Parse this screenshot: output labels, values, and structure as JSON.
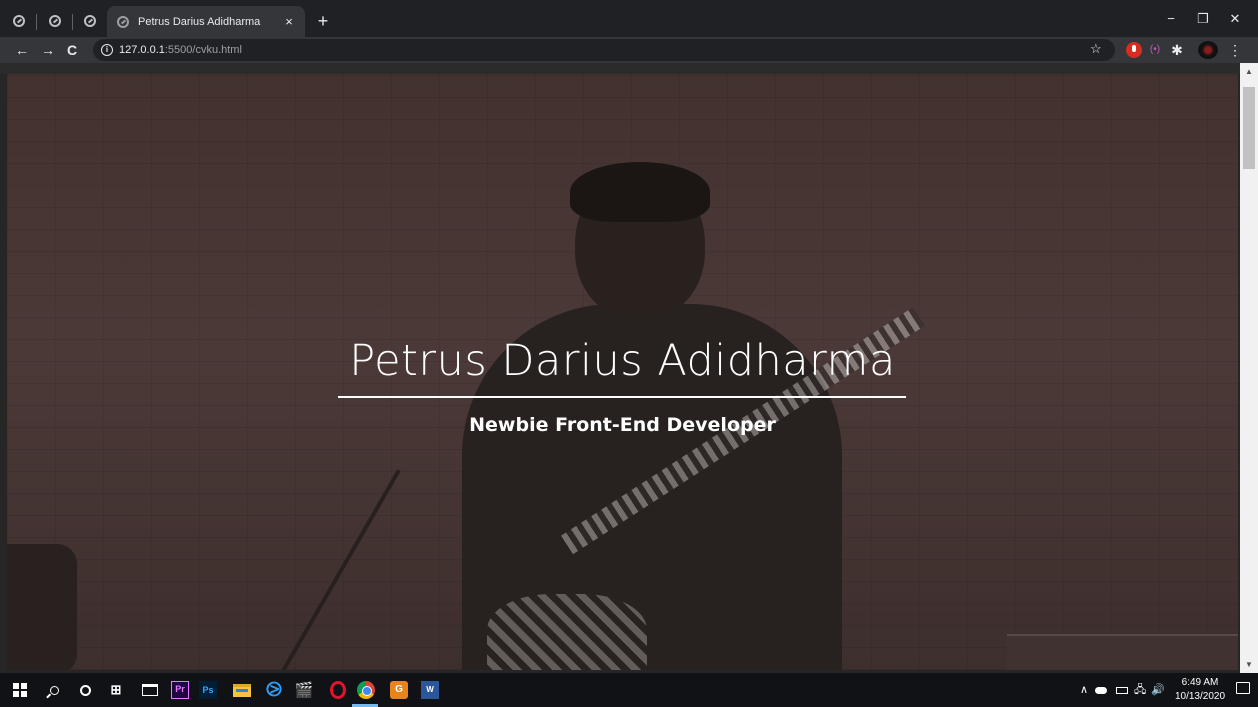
{
  "browser": {
    "pinned_tabs": [
      "",
      "",
      ""
    ],
    "active_tab": {
      "title": "Petrus Darius Adidharma",
      "close": "×"
    },
    "new_tab": "+",
    "window_controls": {
      "minimize": "−",
      "maximize": "❐",
      "close": "✕"
    },
    "toolbar": {
      "back": "←",
      "forward": "→",
      "reload": "C",
      "url_host": "127.0.0.1",
      "url_path": ":5500/cvku.html",
      "bookmark_star": "☆",
      "radio_ext": "(•)",
      "puzzle": "✱",
      "menu": "⋮"
    }
  },
  "hero": {
    "name": "Petrus Darius Adidharma",
    "role": "Newbie Front-End Developer"
  },
  "scrollbar": {
    "up": "▲",
    "down": "▼",
    "position": 0.0
  },
  "taskbar": {
    "task_view": "⊞",
    "vscode": "⧁",
    "clap": "🎬",
    "premiere": "Pr",
    "photoshop": "Ps",
    "app": "G",
    "word": "W",
    "tray_chevron": "∧",
    "network": "🖧",
    "volume": "🔊",
    "time": "6:49 AM",
    "date": "10/13/2020"
  },
  "colors": {
    "tab_strip": "#202124",
    "toolbar": "#35363a",
    "taskbar": "#101216",
    "hero_tint": "#4e3a37",
    "accent_underline": "#76b9ed"
  }
}
